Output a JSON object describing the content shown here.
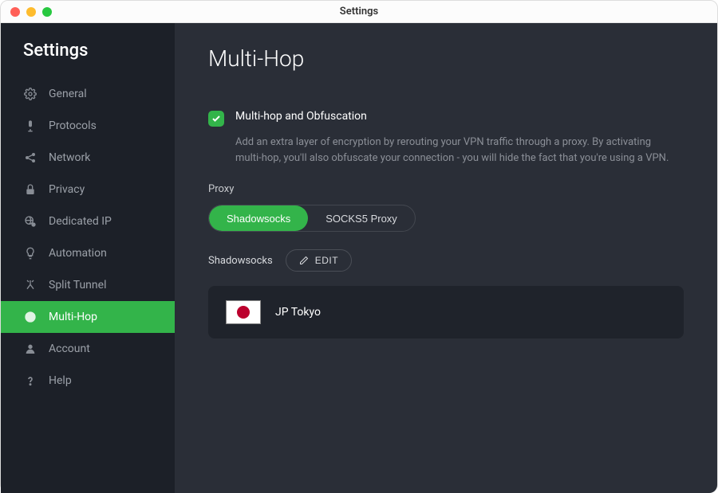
{
  "window": {
    "title": "Settings"
  },
  "sidebar": {
    "title": "Settings",
    "items": [
      {
        "label": "General",
        "icon": "gear-icon"
      },
      {
        "label": "Protocols",
        "icon": "mic-icon"
      },
      {
        "label": "Network",
        "icon": "share-icon"
      },
      {
        "label": "Privacy",
        "icon": "lock-icon"
      },
      {
        "label": "Dedicated IP",
        "icon": "globe-pin-icon"
      },
      {
        "label": "Automation",
        "icon": "bulb-icon"
      },
      {
        "label": "Split Tunnel",
        "icon": "split-icon"
      },
      {
        "label": "Multi-Hop",
        "icon": "globe-icon",
        "active": true
      },
      {
        "label": "Account",
        "icon": "person-icon"
      },
      {
        "label": "Help",
        "icon": "help-icon"
      }
    ]
  },
  "main": {
    "title": "Multi-Hop",
    "option": {
      "label": "Multi-hop and Obfuscation",
      "checked": true,
      "description": "Add an extra layer of encryption by rerouting your VPN traffic through a proxy. By activating multi-hop, you'll also obfuscate your connection - you will hide the fact that you're using a VPN."
    },
    "proxy": {
      "label": "Proxy",
      "options": [
        "Shadowsocks",
        "SOCKS5 Proxy"
      ],
      "selected": "Shadowsocks"
    },
    "shadowsocks": {
      "label": "Shadowsocks",
      "edit_label": "EDIT",
      "server": {
        "name": "JP Tokyo",
        "country": "JP"
      }
    }
  },
  "colors": {
    "accent": "#33b44a"
  }
}
